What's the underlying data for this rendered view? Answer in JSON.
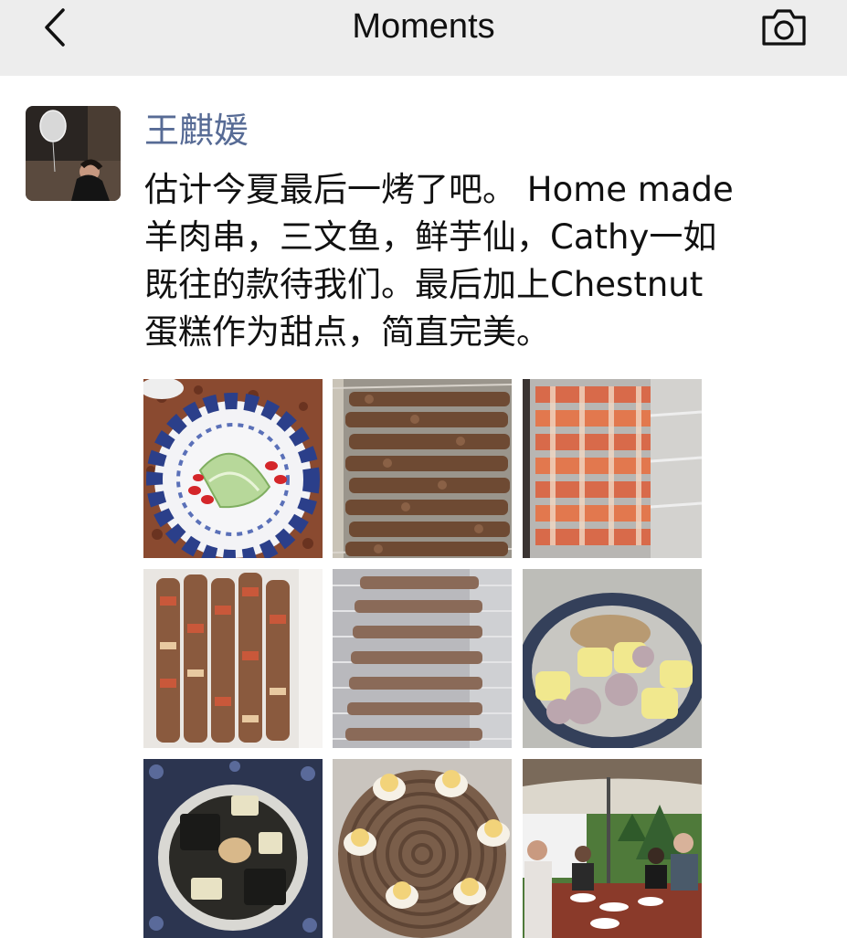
{
  "header": {
    "title": "Moments",
    "back_icon": "chevron-left-icon",
    "camera_icon": "camera-icon",
    "background": "#ededed"
  },
  "post": {
    "username": "王麒媛",
    "username_color": "#576b95",
    "text_lines": [
      "估计今夏最后一烤了吧。 Home made",
      "羊肉串，三文鱼，鲜芋仙，Cathy一如",
      "既往的款待我们。最后加上Chestnut",
      "蛋糕作为甜点，简直完美。"
    ],
    "photos": [
      "salad-plate",
      "lamb-skewers-grill",
      "salmon-skewers-foil",
      "pork-skewers-tray",
      "lamb-skewers-rack",
      "taro-balls-dessert",
      "grass-jelly-dessert",
      "chestnut-cake",
      "dinner-party-table"
    ]
  }
}
